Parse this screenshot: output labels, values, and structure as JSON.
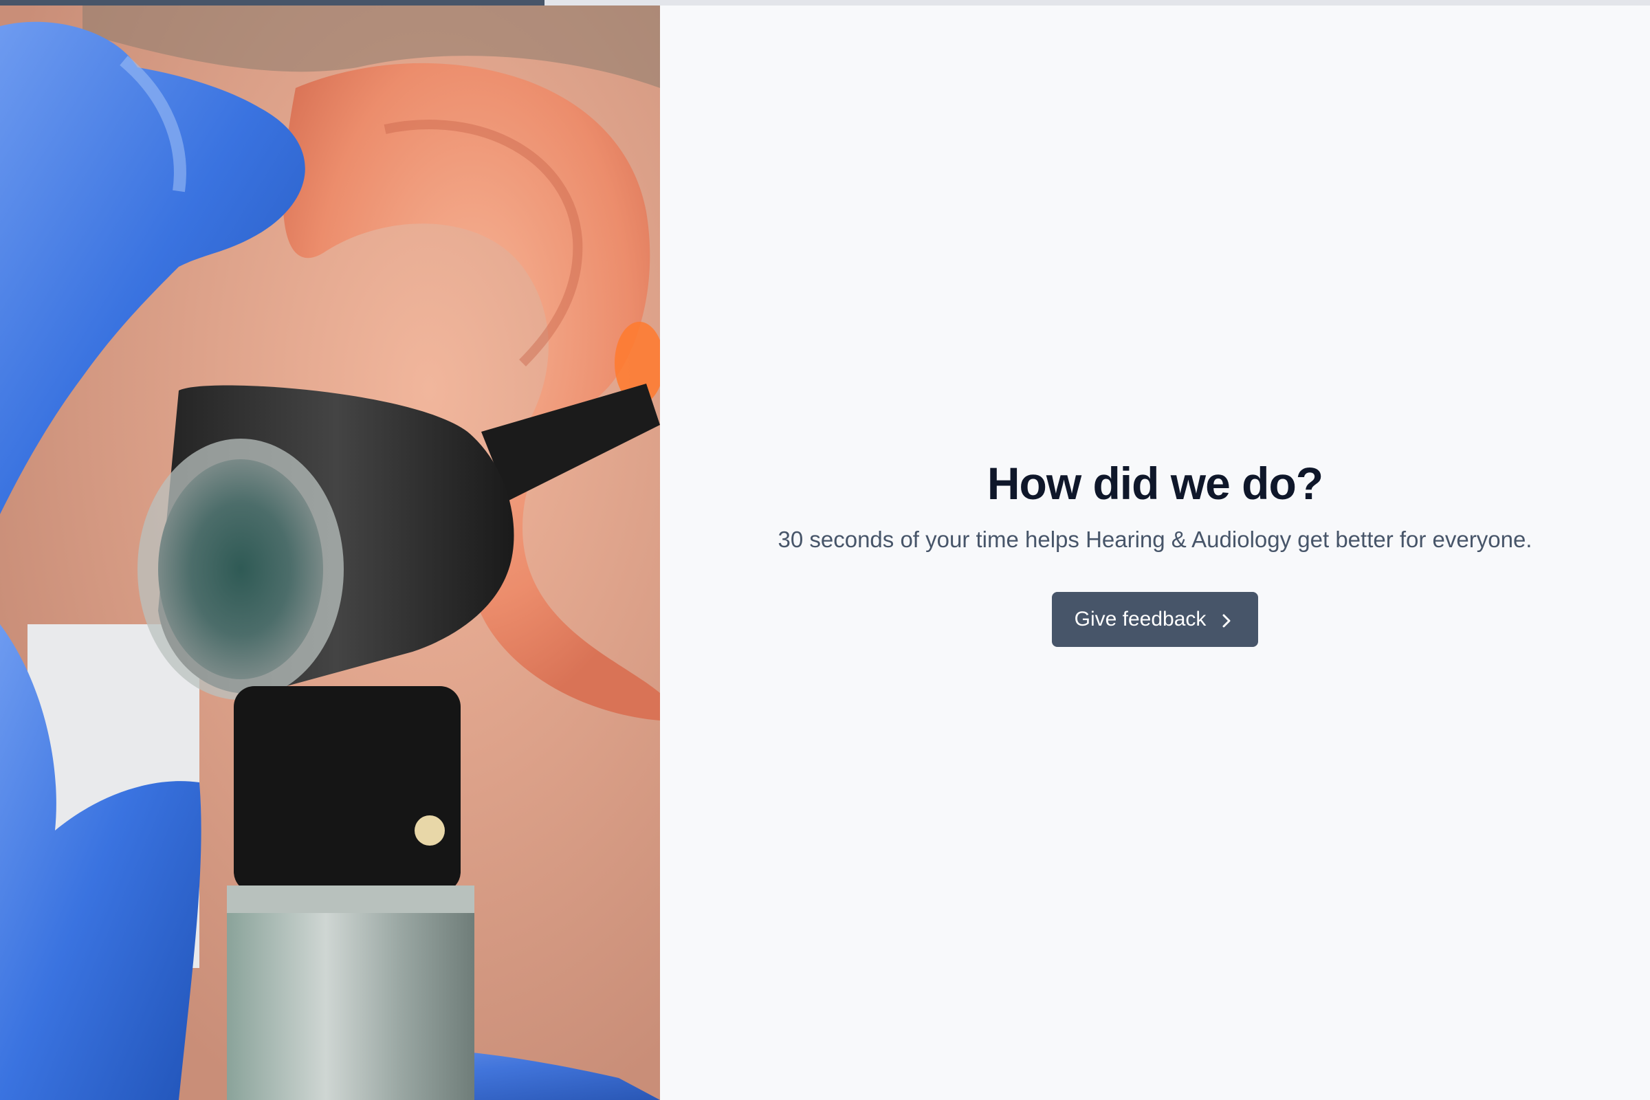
{
  "progress": {
    "fraction": 0.33
  },
  "hero": {
    "icon": "ear-exam-photo",
    "glove_color": "#3a73e0",
    "skin_color": "#e9a48a"
  },
  "main": {
    "title": "How did we do?",
    "subtitle": "30 seconds of your time helps Hearing & Audiology get better for everyone.",
    "button_label": "Give feedback",
    "button_icon": "chevron-right-icon"
  },
  "colors": {
    "accent": "#475569",
    "background": "#f8f9fb",
    "title": "#0f172a",
    "subtitle": "#475569"
  }
}
